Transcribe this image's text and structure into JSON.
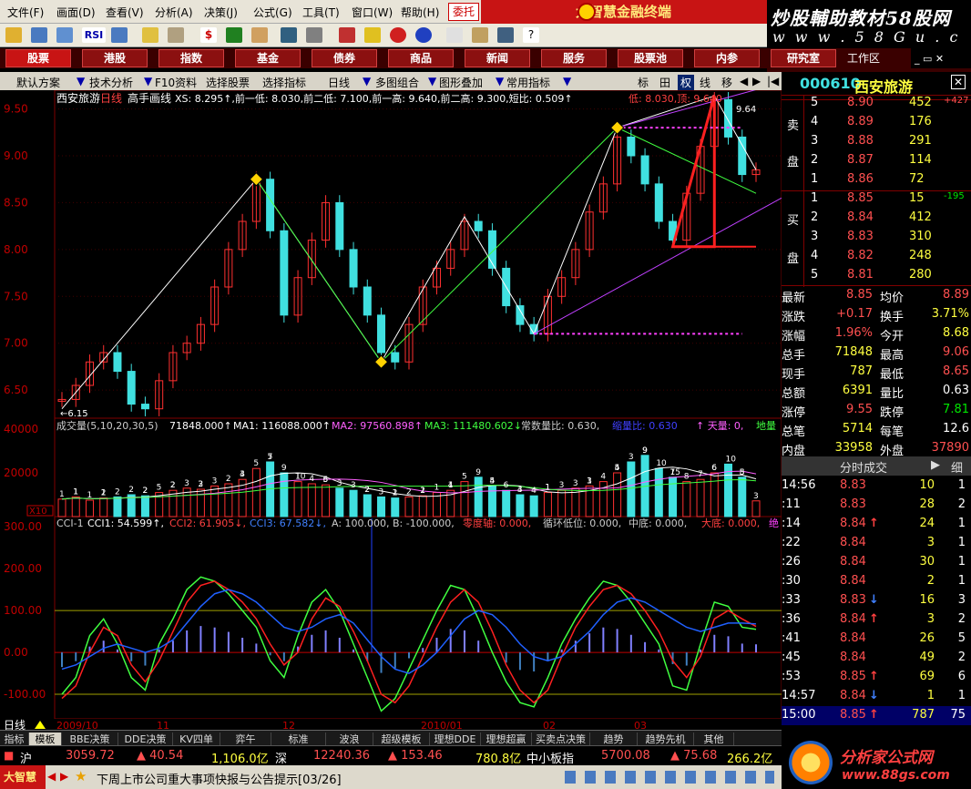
{
  "menu": [
    "文件(F)",
    "画面(D)",
    "查看(V)",
    "分析(A)",
    "决策(J)",
    "公式(G)",
    "工具(T)",
    "窗口(W)",
    "帮助(H)"
  ],
  "entrust": "委托",
  "brand": "大智慧金融终端",
  "watermark_top": {
    "line1": "炒股輔助教材58股网",
    "line2": "w w w . 5 8 G u . c o m"
  },
  "tabs": [
    "股票",
    "港股",
    "指数",
    "基金",
    "债券",
    "商品",
    "新闻",
    "服务",
    "股票池",
    "内参",
    "研究室"
  ],
  "workarea": "工作区",
  "subbar": {
    "items": [
      "默认方案",
      "技术分析",
      "F10资料",
      "选择股票",
      "选择指标",
      "日线",
      "多图组合",
      "图形叠加",
      "常用指标"
    ],
    "right_btns": [
      "标",
      "田",
      "权",
      "线",
      "移"
    ]
  },
  "chart_header": {
    "name": "西安旅游",
    "period": "日线",
    "indicator": "高手画线",
    "values": "XS: 8.295↑,前一低: 8.030,前二低: 7.100,前一高: 9.640,前二高: 9.300,短比: 0.509↑",
    "extra": "低: 8.030,顶: 9.640",
    "right_mark": "9.64"
  },
  "price_axis": [
    "9.50",
    "9.00",
    "8.50",
    "8.00",
    "7.50",
    "7.00",
    "6.50"
  ],
  "price_marks": {
    "low": "6.15"
  },
  "volume_header": {
    "label": "成交量(5,10,20,30,5)",
    "vol": "71848.000↑",
    "ma1": "MA1: 116088.000↑",
    "ma2": "MA2: 97560.898↑",
    "ma3": "MA3: 111480.602↓",
    "ratio": "常数量比: 0.630,",
    "tag1": "缩量比: 0.630",
    "tag2": "↑ 天量: 0,",
    "tag3": "地量"
  },
  "volume_axis": [
    "40000",
    "20000",
    "X10"
  ],
  "volume_counts": [
    "1",
    "1",
    "1",
    "1",
    "1",
    "2",
    "2",
    "2",
    "2",
    "2",
    "5",
    "2",
    "2",
    "3",
    "3",
    "2",
    "3",
    "2",
    "3",
    "4",
    "5",
    "5",
    "7",
    "9",
    "T",
    "10",
    "4",
    "5",
    "6",
    "3",
    "3",
    "2",
    "2",
    "3",
    "2",
    "1",
    "2",
    "2",
    "1",
    "1",
    "1",
    "4",
    "5",
    "9",
    "4",
    "5",
    "6",
    "3",
    "4",
    "4",
    "1",
    "1",
    "3",
    "3",
    "3",
    "1",
    "4",
    "5",
    "4",
    "3",
    "9",
    "9",
    "10",
    "15",
    "7",
    "8",
    "7",
    "6",
    "6",
    "10",
    "8",
    "5",
    "3"
  ],
  "cci_header": {
    "label": "CCI-1",
    "cci1": "CCI1: 54.599↑,",
    "cci2": "CCI2: 61.905↓,",
    "cci3": "CCI3: 67.582↓,",
    "a": "A: 100.000, B: -100.000,",
    "zero": "零度轴: 0.000,",
    "cyc": "循环低位: 0.000,",
    "mid": "中底: 0.000,",
    "big": "大底: 0.000,",
    "last": "绝"
  },
  "cci_axis": [
    "300.00",
    "200.00",
    "100.00",
    "0.00",
    "-100.00"
  ],
  "date_axis": [
    "2009/10",
    "11",
    "12",
    "2010/01",
    "02",
    "03"
  ],
  "period_label": "日线",
  "quote": {
    "code": "000610",
    "name": "西安旅游",
    "sell_label": [
      "卖",
      "盘"
    ],
    "buy_label": [
      "买",
      "盘"
    ],
    "asks": [
      {
        "lvl": "5",
        "price": "8.90",
        "vol": "452",
        "chg": "+427"
      },
      {
        "lvl": "4",
        "price": "8.89",
        "vol": "176",
        "chg": ""
      },
      {
        "lvl": "3",
        "price": "8.88",
        "vol": "291",
        "chg": ""
      },
      {
        "lvl": "2",
        "price": "8.87",
        "vol": "114",
        "chg": ""
      },
      {
        "lvl": "1",
        "price": "8.86",
        "vol": "72",
        "chg": ""
      }
    ],
    "bids": [
      {
        "lvl": "1",
        "price": "8.85",
        "vol": "15",
        "chg": "-195"
      },
      {
        "lvl": "2",
        "price": "8.84",
        "vol": "412",
        "chg": ""
      },
      {
        "lvl": "3",
        "price": "8.83",
        "vol": "310",
        "chg": ""
      },
      {
        "lvl": "4",
        "price": "8.82",
        "vol": "248",
        "chg": ""
      },
      {
        "lvl": "5",
        "price": "8.81",
        "vol": "280",
        "chg": ""
      }
    ],
    "stats": [
      {
        "k1": "最新",
        "v1": "8.85",
        "k2": "均价",
        "v2": "8.89"
      },
      {
        "k1": "涨跌",
        "v1": "+0.17",
        "k2": "换手",
        "v2": "3.71%"
      },
      {
        "k1": "涨幅",
        "v1": "1.96%",
        "k2": "今开",
        "v2": "8.68"
      },
      {
        "k1": "总手",
        "v1": "71848",
        "k2": "最高",
        "v2": "9.06"
      },
      {
        "k1": "现手",
        "v1": "787",
        "k2": "最低",
        "v2": "8.65"
      },
      {
        "k1": "总额",
        "v1": "6391",
        "k2": "量比",
        "v2": "0.63"
      },
      {
        "k1": "涨停",
        "v1": "9.55",
        "k2": "跌停",
        "v2": "7.81"
      },
      {
        "k1": "总笔",
        "v1": "5714",
        "k2": "每笔",
        "v2": "12.6"
      },
      {
        "k1": "内盘",
        "v1": "33958",
        "k2": "外盘",
        "v2": "37890"
      }
    ],
    "trades_tab": "分时成交",
    "trades_tab2": "细",
    "trades": [
      {
        "t": "14:56",
        "p": "8.83",
        "arrow": "",
        "v": "10",
        "n": "1"
      },
      {
        "t": ":11",
        "p": "8.83",
        "arrow": "",
        "v": "28",
        "n": "2"
      },
      {
        "t": ":14",
        "p": "8.84",
        "arrow": "↑",
        "v": "24",
        "n": "1"
      },
      {
        "t": ":22",
        "p": "8.84",
        "arrow": "",
        "v": "3",
        "n": "1"
      },
      {
        "t": ":26",
        "p": "8.84",
        "arrow": "",
        "v": "30",
        "n": "1"
      },
      {
        "t": ":30",
        "p": "8.84",
        "arrow": "",
        "v": "2",
        "n": "1"
      },
      {
        "t": ":33",
        "p": "8.83",
        "arrow": "↓",
        "v": "16",
        "n": "3"
      },
      {
        "t": ":36",
        "p": "8.84",
        "arrow": "↑",
        "v": "3",
        "n": "2"
      },
      {
        "t": ":41",
        "p": "8.84",
        "arrow": "",
        "v": "26",
        "n": "5"
      },
      {
        "t": ":45",
        "p": "8.84",
        "arrow": "",
        "v": "49",
        "n": "2"
      },
      {
        "t": ":53",
        "p": "8.85",
        "arrow": "↑",
        "v": "69",
        "n": "6"
      },
      {
        "t": "14:57",
        "p": "8.84",
        "arrow": "↓",
        "v": "1",
        "n": "1"
      },
      {
        "t": "15:00",
        "p": "8.85",
        "arrow": "↑",
        "v": "787",
        "n": "75"
      }
    ]
  },
  "bottom_tabs": [
    "指标",
    "模板",
    "BBE决策",
    "DDE决策",
    "KV四单",
    "弈午",
    "标准",
    "波浪",
    "超级模板",
    "理想DDE",
    "理想超赢",
    "买卖点决策",
    "趋势",
    "趋势先机",
    "其他"
  ],
  "ticker": {
    "sh_label": "沪",
    "sh": "3059.72",
    "sh_chg": "▲ 40.54",
    "sh_amt": "1,106.0亿",
    "sz_label": "深",
    "sz": "12240.36",
    "sz_chg": "▲ 153.46",
    "sz_amt": "780.8亿",
    "zx_label": "中小板指",
    "zx": "5700.08",
    "zx_chg": "▲ 75.68",
    "zx_amt": "266.2亿"
  },
  "footer": {
    "brand": "大智慧",
    "news": "下周上市公司重大事项快报与公告提示[03/26]"
  },
  "logo_bottom": {
    "line1": "分析家公式网",
    "line2": "www.88gs.com"
  },
  "chart_data": [
    {
      "type": "line",
      "title": "西安旅游 日线",
      "ylim": [
        6.2,
        9.7
      ],
      "y_ticks": [
        9.5,
        9.0,
        8.5,
        8.0,
        7.5,
        7.0,
        6.5
      ],
      "series": [
        {
          "name": "",
          "values": [
            6.4,
            6.55,
            6.8,
            6.9,
            6.7,
            6.35,
            6.3,
            6.6,
            6.9,
            7.0,
            7.2,
            7.6,
            8.0,
            8.3,
            8.75,
            8.2,
            7.3,
            7.7,
            8.1,
            8.5,
            8.0,
            7.6,
            7.3,
            6.9,
            6.8,
            7.2,
            7.6,
            7.8,
            8.0,
            8.3,
            8.2,
            7.8,
            7.4,
            7.2,
            7.1,
            7.5,
            7.7,
            8.0,
            8.4,
            8.7,
            9.2,
            9.0,
            8.7,
            8.3,
            8.1,
            8.6,
            9.1,
            9.6,
            9.2,
            8.8,
            8.85
          ]
        }
      ],
      "lows": [
        6.15,
        6.8,
        7.1,
        8.03
      ],
      "highs": [
        8.75,
        8.55,
        8.35,
        9.3,
        9.64
      ]
    },
    {
      "type": "bar",
      "title": "成交量",
      "ylim": [
        0,
        40000
      ],
      "y_ticks": [
        40000,
        20000
      ],
      "values": [
        8000,
        9000,
        7500,
        8500,
        9000,
        10000,
        9500,
        11000,
        12000,
        13000,
        12500,
        14000,
        15000,
        17000,
        22000,
        25000,
        20000,
        16000,
        15000,
        14500,
        13000,
        12000,
        10000,
        9000,
        8500,
        9000,
        9500,
        11000,
        12000,
        16000,
        18000,
        14000,
        12000,
        10000,
        9500,
        11000,
        12000,
        13000,
        14000,
        16000,
        20000,
        25000,
        28000,
        22000,
        18000,
        16000,
        17000,
        20000,
        24000,
        18000,
        7185
      ]
    },
    {
      "type": "line",
      "title": "CCI-1",
      "ylim": [
        -150,
        320
      ],
      "y_ticks": [
        300,
        200,
        100,
        0,
        -100
      ],
      "series": [
        {
          "name": "CCI1",
          "values": [
            -100,
            -60,
            40,
            80,
            20,
            -60,
            -90,
            20,
            80,
            150,
            180,
            170,
            140,
            100,
            60,
            -20,
            -60,
            40,
            120,
            150,
            100,
            20,
            -60,
            -140,
            -110,
            -40,
            30,
            100,
            160,
            150,
            80,
            0,
            -70,
            -120,
            -130,
            -60,
            20,
            80,
            130,
            170,
            160,
            120,
            70,
            20,
            -80,
            -90,
            20,
            120,
            110,
            60,
            55
          ]
        },
        {
          "name": "CCI2",
          "values": [
            -110,
            -80,
            0,
            60,
            40,
            -30,
            -70,
            -20,
            50,
            120,
            160,
            170,
            150,
            120,
            80,
            20,
            -30,
            0,
            80,
            130,
            110,
            50,
            -20,
            -100,
            -120,
            -80,
            -10,
            60,
            120,
            150,
            120,
            50,
            -30,
            -90,
            -120,
            -90,
            -10,
            60,
            110,
            150,
            160,
            140,
            100,
            50,
            -20,
            -60,
            -10,
            80,
            100,
            80,
            62
          ]
        },
        {
          "name": "CCI3",
          "values": [
            -40,
            -30,
            -10,
            10,
            20,
            10,
            0,
            10,
            30,
            70,
            110,
            140,
            150,
            140,
            120,
            90,
            60,
            50,
            60,
            80,
            90,
            70,
            30,
            -10,
            -40,
            -50,
            -30,
            0,
            40,
            80,
            100,
            90,
            60,
            20,
            -10,
            -20,
            -10,
            20,
            50,
            90,
            120,
            130,
            120,
            100,
            80,
            60,
            50,
            60,
            70,
            70,
            68
          ]
        }
      ]
    }
  ]
}
